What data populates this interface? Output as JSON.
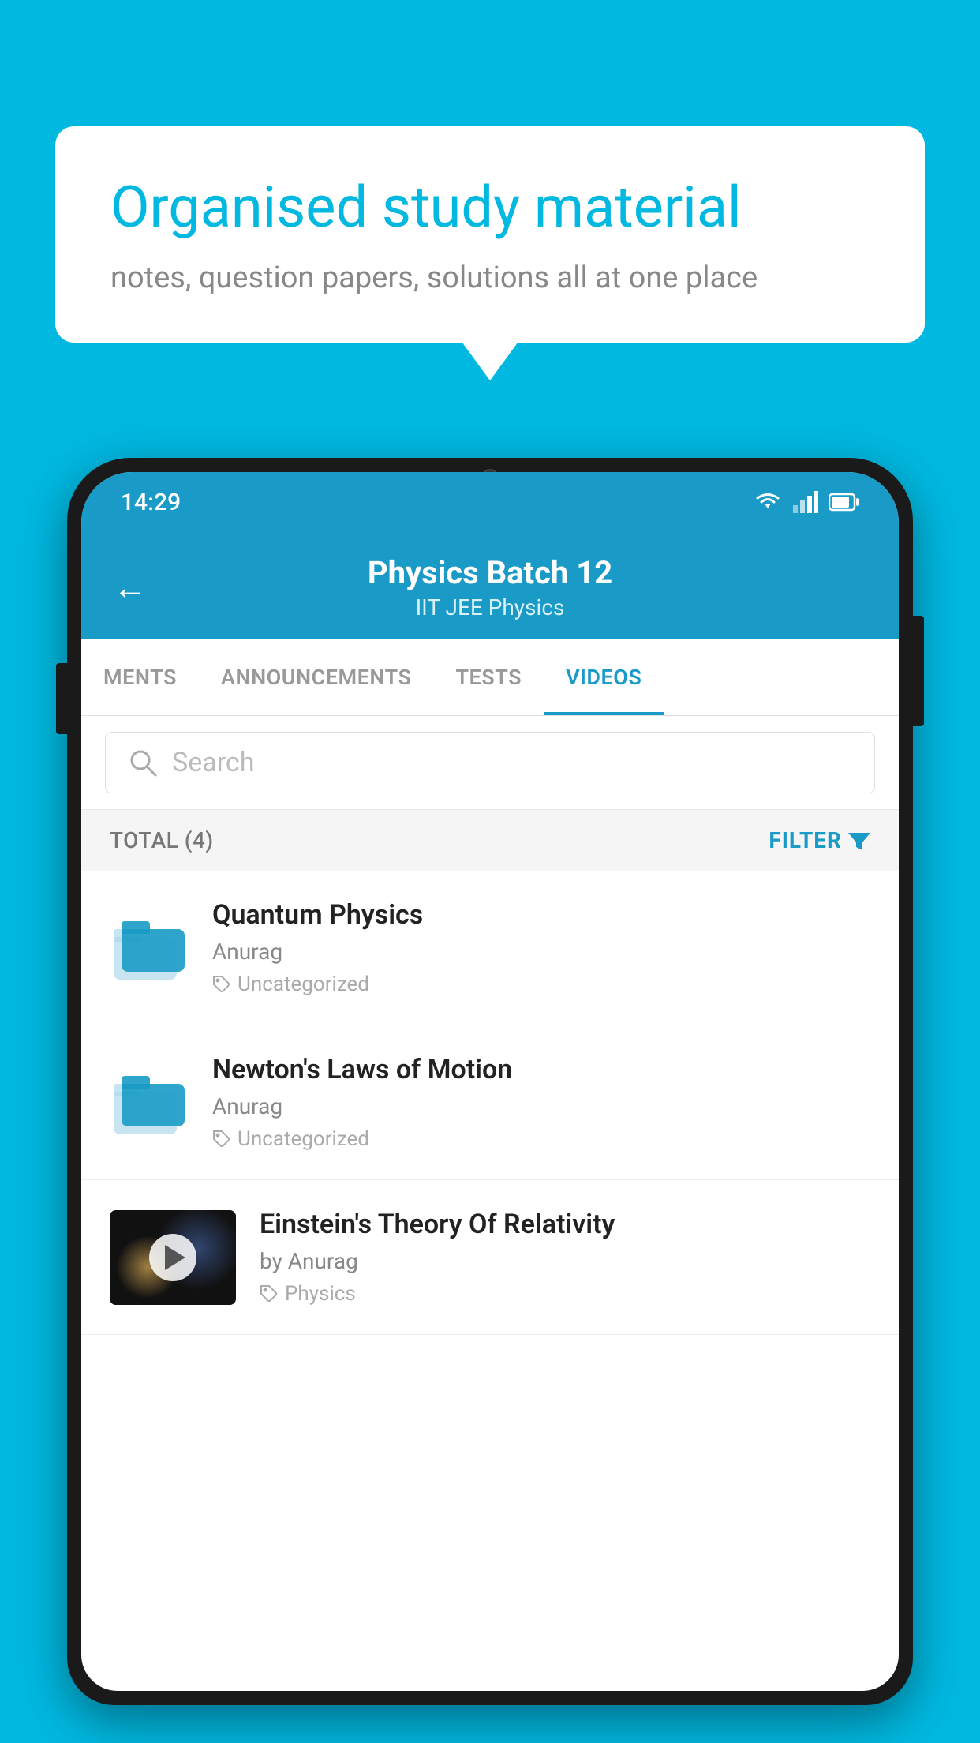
{
  "background_color": "#00b8e0",
  "speech_bubble": {
    "title": "Organised study material",
    "subtitle": "notes, question papers, solutions all at one place"
  },
  "phone": {
    "status_bar": {
      "time": "14:29",
      "wifi": "wifi-icon",
      "signal": "signal-icon",
      "battery": "battery-icon"
    },
    "header": {
      "back_label": "←",
      "title": "Physics Batch 12",
      "subtitle": "IIT JEE   Physics"
    },
    "tabs": [
      {
        "label": "MENTS",
        "active": false
      },
      {
        "label": "ANNOUNCEMENTS",
        "active": false
      },
      {
        "label": "TESTS",
        "active": false
      },
      {
        "label": "VIDEOS",
        "active": true
      }
    ],
    "search": {
      "placeholder": "Search"
    },
    "filter_row": {
      "total_label": "TOTAL (4)",
      "filter_label": "FILTER"
    },
    "videos": [
      {
        "id": 1,
        "title": "Quantum Physics",
        "author": "Anurag",
        "tag": "Uncategorized",
        "has_thumbnail": false
      },
      {
        "id": 2,
        "title": "Newton's Laws of Motion",
        "author": "Anurag",
        "tag": "Uncategorized",
        "has_thumbnail": false
      },
      {
        "id": 3,
        "title": "Einstein's Theory Of Relativity",
        "author": "by Anurag",
        "tag": "Physics",
        "has_thumbnail": true
      }
    ]
  }
}
